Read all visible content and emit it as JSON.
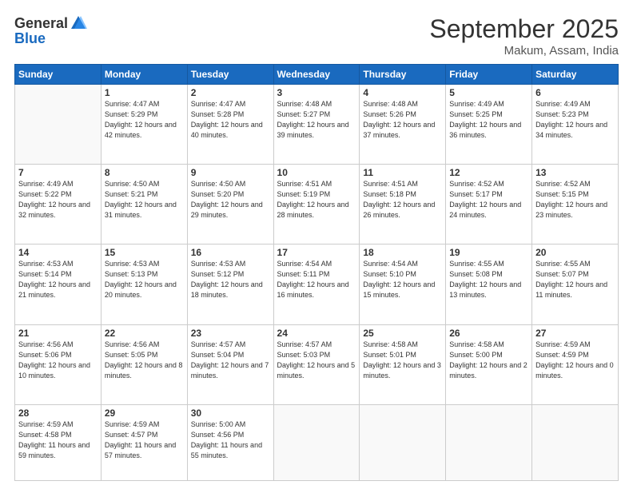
{
  "header": {
    "logo_general": "General",
    "logo_blue": "Blue",
    "month_title": "September 2025",
    "location": "Makum, Assam, India"
  },
  "weekdays": [
    "Sunday",
    "Monday",
    "Tuesday",
    "Wednesday",
    "Thursday",
    "Friday",
    "Saturday"
  ],
  "weeks": [
    [
      {
        "day": "",
        "empty": true
      },
      {
        "day": "1",
        "sunrise": "Sunrise: 4:47 AM",
        "sunset": "Sunset: 5:29 PM",
        "daylight": "Daylight: 12 hours and 42 minutes."
      },
      {
        "day": "2",
        "sunrise": "Sunrise: 4:47 AM",
        "sunset": "Sunset: 5:28 PM",
        "daylight": "Daylight: 12 hours and 40 minutes."
      },
      {
        "day": "3",
        "sunrise": "Sunrise: 4:48 AM",
        "sunset": "Sunset: 5:27 PM",
        "daylight": "Daylight: 12 hours and 39 minutes."
      },
      {
        "day": "4",
        "sunrise": "Sunrise: 4:48 AM",
        "sunset": "Sunset: 5:26 PM",
        "daylight": "Daylight: 12 hours and 37 minutes."
      },
      {
        "day": "5",
        "sunrise": "Sunrise: 4:49 AM",
        "sunset": "Sunset: 5:25 PM",
        "daylight": "Daylight: 12 hours and 36 minutes."
      },
      {
        "day": "6",
        "sunrise": "Sunrise: 4:49 AM",
        "sunset": "Sunset: 5:23 PM",
        "daylight": "Daylight: 12 hours and 34 minutes."
      }
    ],
    [
      {
        "day": "7",
        "sunrise": "Sunrise: 4:49 AM",
        "sunset": "Sunset: 5:22 PM",
        "daylight": "Daylight: 12 hours and 32 minutes."
      },
      {
        "day": "8",
        "sunrise": "Sunrise: 4:50 AM",
        "sunset": "Sunset: 5:21 PM",
        "daylight": "Daylight: 12 hours and 31 minutes."
      },
      {
        "day": "9",
        "sunrise": "Sunrise: 4:50 AM",
        "sunset": "Sunset: 5:20 PM",
        "daylight": "Daylight: 12 hours and 29 minutes."
      },
      {
        "day": "10",
        "sunrise": "Sunrise: 4:51 AM",
        "sunset": "Sunset: 5:19 PM",
        "daylight": "Daylight: 12 hours and 28 minutes."
      },
      {
        "day": "11",
        "sunrise": "Sunrise: 4:51 AM",
        "sunset": "Sunset: 5:18 PM",
        "daylight": "Daylight: 12 hours and 26 minutes."
      },
      {
        "day": "12",
        "sunrise": "Sunrise: 4:52 AM",
        "sunset": "Sunset: 5:17 PM",
        "daylight": "Daylight: 12 hours and 24 minutes."
      },
      {
        "day": "13",
        "sunrise": "Sunrise: 4:52 AM",
        "sunset": "Sunset: 5:15 PM",
        "daylight": "Daylight: 12 hours and 23 minutes."
      }
    ],
    [
      {
        "day": "14",
        "sunrise": "Sunrise: 4:53 AM",
        "sunset": "Sunset: 5:14 PM",
        "daylight": "Daylight: 12 hours and 21 minutes."
      },
      {
        "day": "15",
        "sunrise": "Sunrise: 4:53 AM",
        "sunset": "Sunset: 5:13 PM",
        "daylight": "Daylight: 12 hours and 20 minutes."
      },
      {
        "day": "16",
        "sunrise": "Sunrise: 4:53 AM",
        "sunset": "Sunset: 5:12 PM",
        "daylight": "Daylight: 12 hours and 18 minutes."
      },
      {
        "day": "17",
        "sunrise": "Sunrise: 4:54 AM",
        "sunset": "Sunset: 5:11 PM",
        "daylight": "Daylight: 12 hours and 16 minutes."
      },
      {
        "day": "18",
        "sunrise": "Sunrise: 4:54 AM",
        "sunset": "Sunset: 5:10 PM",
        "daylight": "Daylight: 12 hours and 15 minutes."
      },
      {
        "day": "19",
        "sunrise": "Sunrise: 4:55 AM",
        "sunset": "Sunset: 5:08 PM",
        "daylight": "Daylight: 12 hours and 13 minutes."
      },
      {
        "day": "20",
        "sunrise": "Sunrise: 4:55 AM",
        "sunset": "Sunset: 5:07 PM",
        "daylight": "Daylight: 12 hours and 11 minutes."
      }
    ],
    [
      {
        "day": "21",
        "sunrise": "Sunrise: 4:56 AM",
        "sunset": "Sunset: 5:06 PM",
        "daylight": "Daylight: 12 hours and 10 minutes."
      },
      {
        "day": "22",
        "sunrise": "Sunrise: 4:56 AM",
        "sunset": "Sunset: 5:05 PM",
        "daylight": "Daylight: 12 hours and 8 minutes."
      },
      {
        "day": "23",
        "sunrise": "Sunrise: 4:57 AM",
        "sunset": "Sunset: 5:04 PM",
        "daylight": "Daylight: 12 hours and 7 minutes."
      },
      {
        "day": "24",
        "sunrise": "Sunrise: 4:57 AM",
        "sunset": "Sunset: 5:03 PM",
        "daylight": "Daylight: 12 hours and 5 minutes."
      },
      {
        "day": "25",
        "sunrise": "Sunrise: 4:58 AM",
        "sunset": "Sunset: 5:01 PM",
        "daylight": "Daylight: 12 hours and 3 minutes."
      },
      {
        "day": "26",
        "sunrise": "Sunrise: 4:58 AM",
        "sunset": "Sunset: 5:00 PM",
        "daylight": "Daylight: 12 hours and 2 minutes."
      },
      {
        "day": "27",
        "sunrise": "Sunrise: 4:59 AM",
        "sunset": "Sunset: 4:59 PM",
        "daylight": "Daylight: 12 hours and 0 minutes."
      }
    ],
    [
      {
        "day": "28",
        "sunrise": "Sunrise: 4:59 AM",
        "sunset": "Sunset: 4:58 PM",
        "daylight": "Daylight: 11 hours and 59 minutes."
      },
      {
        "day": "29",
        "sunrise": "Sunrise: 4:59 AM",
        "sunset": "Sunset: 4:57 PM",
        "daylight": "Daylight: 11 hours and 57 minutes."
      },
      {
        "day": "30",
        "sunrise": "Sunrise: 5:00 AM",
        "sunset": "Sunset: 4:56 PM",
        "daylight": "Daylight: 11 hours and 55 minutes."
      },
      {
        "day": "",
        "empty": true
      },
      {
        "day": "",
        "empty": true
      },
      {
        "day": "",
        "empty": true
      },
      {
        "day": "",
        "empty": true
      }
    ]
  ]
}
